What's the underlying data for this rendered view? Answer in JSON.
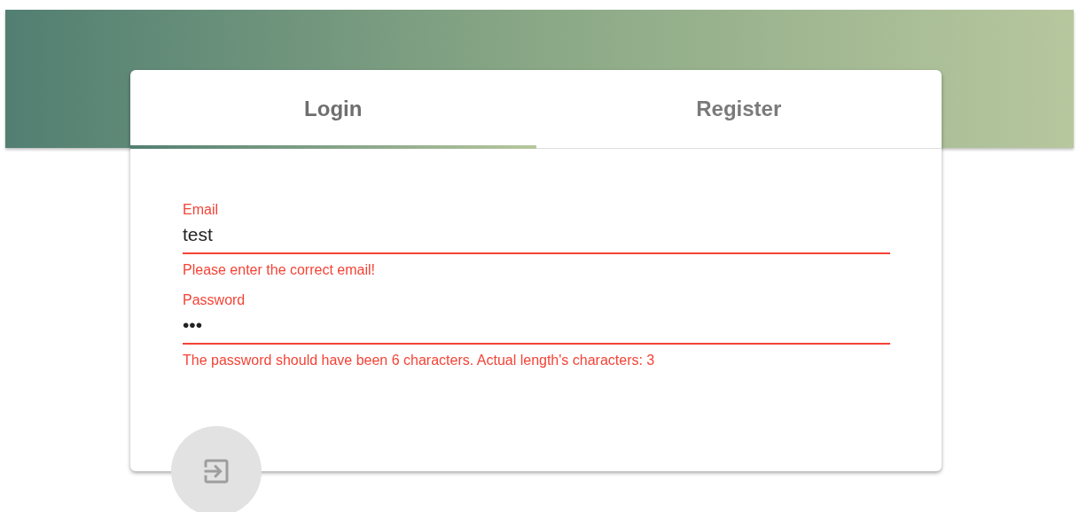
{
  "tabs": [
    {
      "label": "Login",
      "selected": true
    },
    {
      "label": "Register",
      "selected": false
    }
  ],
  "fields": [
    {
      "label": "Email",
      "value": "test",
      "invalid": true,
      "error": "Please enter the correct email!"
    },
    {
      "label": "Password",
      "value": "•••",
      "invalid": true,
      "error": "The password should have been 6 characters. Actual length's characters: 3"
    }
  ],
  "submit": {
    "disabled": true
  }
}
